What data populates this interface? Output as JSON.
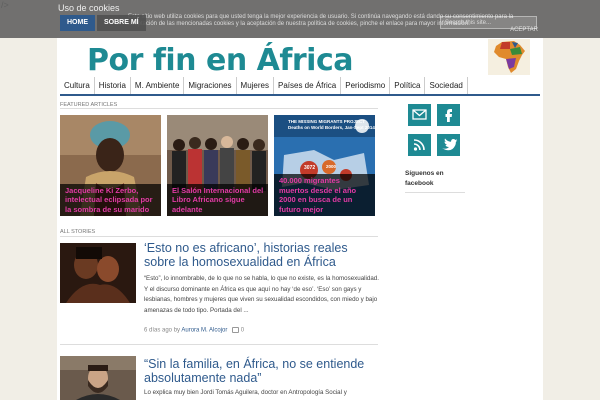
{
  "stray_text": "/>",
  "cookie": {
    "title": "Uso de cookies",
    "text": "Este sitio web utiliza cookies para que usted tenga la mejor experiencia de usuario. Si continúa navegando está dando su consentimiento para la aceptación de las mencionadas cookies y la aceptación de nuestra política de cookies, pinche el enlace para mayor información.",
    "accept": "ACEPTAR"
  },
  "topnav": {
    "home": "HOME",
    "about": "SOBRE MÍ"
  },
  "search": {
    "placeholder": "Search this site..."
  },
  "site": {
    "title": "Por fin en África"
  },
  "nav": [
    "Cultura",
    "Historia",
    "M. Ambiente",
    "Migraciones",
    "Mujeres",
    "Países de África",
    "Periodismo",
    "Política",
    "Sociedad"
  ],
  "featured": {
    "label": "FEATURED ARTICLES",
    "items": [
      {
        "title": "Jacqueline Ki Zerbo, intelectual eclipsada por la sombra de su marido"
      },
      {
        "title": "El Salón Internacional del Libro Africano sigue adelante"
      },
      {
        "title": "40.000 migrantes muertos desde el año 2000 en busca de un futuro mejor",
        "banner": "THE MISSING MIGRANTS PROJECT",
        "banner2": "Deaths on World Borders, Jan-Sept 2014",
        "numbers": [
          "3072",
          "2000"
        ]
      }
    ]
  },
  "all_stories": {
    "label": "ALL STORIES",
    "items": [
      {
        "title": "‘Esto no es africano’, historias reales sobre la homosexualidad en África",
        "excerpt": "“Esto”, lo innombrable, de lo que no se habla, lo que no existe, es la homosexualidad. Y el discurso dominante en África es que aquí no hay ‘de eso’. ‘Eso’ son gays y lesbianas, hombres y mujeres que viven su sexualidad escondidos, con miedo y bajo amenazas de todo tipo. Portada del ...",
        "date": "6 días ago by",
        "author": "Aurora M. Alcojor",
        "comments": "0"
      },
      {
        "title": "“Sin la familia, en África, no se entiende absolutamente nada”",
        "excerpt": "Lo explica  muy bien Jordi Tomás Aguilera, doctor en Antropología Social y"
      }
    ]
  },
  "sidebar": {
    "facebook_label": "Síguenos en facebook"
  }
}
